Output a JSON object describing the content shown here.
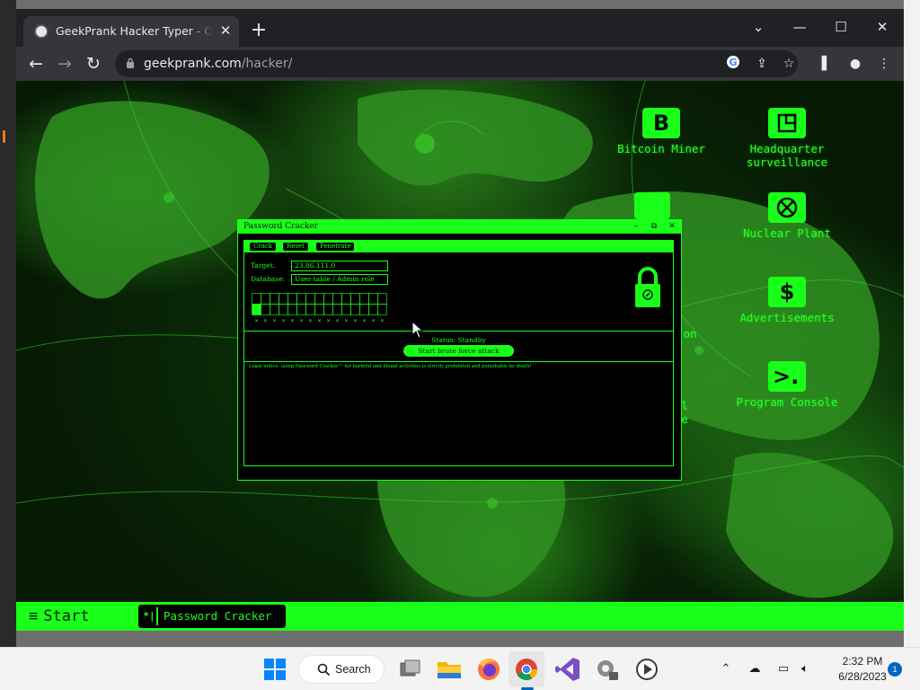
{
  "browser": {
    "tab_title": "GeekPrank Hacker Typer - Online",
    "url_host": "geekprank.com",
    "url_path": "/hacker/",
    "controls": {
      "minimize": "—",
      "maximize": "☐",
      "close": "✕",
      "tab_list": "⌄"
    }
  },
  "desktop": {
    "icons": [
      {
        "label": "Bitcoin Miner",
        "glyph": "B"
      },
      {
        "label": "Headquarter surveillance",
        "glyph": ""
      },
      {
        "label": "Nuclear Plant",
        "glyph": ""
      },
      {
        "label": "Advertisements",
        "glyph": "$"
      },
      {
        "label": "Program Console",
        "glyph": ">."
      }
    ],
    "hidden_fragments": {
      "a": "d",
      "b": "on",
      "c": "l",
      "d": "e"
    }
  },
  "password_cracker": {
    "title": "Password Cracker",
    "menu": [
      "Crack",
      "Reset",
      "Penetrate"
    ],
    "target_label": "Target:",
    "target_value": "23.86.111.0",
    "database_label": "Database:",
    "database_value": "User table / Admin role",
    "status": "Status: Standby",
    "start_button": "Start brute force attack",
    "legal_notice": "Legal notice: using Password Cracker™ for harmful and illegal activities is strictly prohibited and punishable by death!",
    "grid_columns": 15,
    "grid_filled_cells": 1
  },
  "page_taskbar": {
    "start_label": "Start",
    "start_icon": "≡",
    "task_icon": "*|",
    "task_label": "Password Cracker"
  },
  "windows_taskbar": {
    "search_label": "Search",
    "time": "2:32 PM",
    "date": "6/28/2023",
    "notification_count": "1"
  },
  "colors": {
    "terminal_green": "#19ff19",
    "accent_blue": "#0067c0"
  }
}
